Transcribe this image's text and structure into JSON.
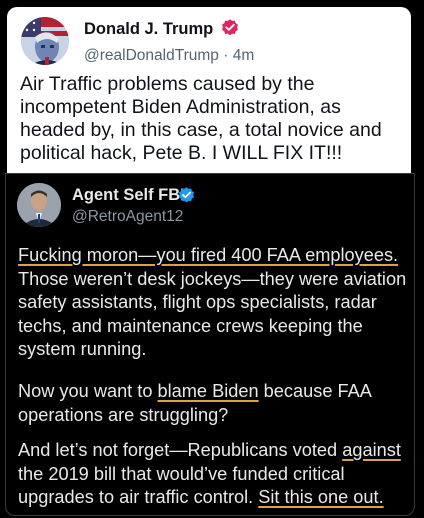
{
  "top_post": {
    "name": "Donald J. Trump",
    "handle": "@realDonaldTrump",
    "separator": "·",
    "time": "4m",
    "text": "Air Traffic problems caused by the incompetent Biden Administration, as headed by, in this case, a total novice and political hack, Pete B. I WILL FIX IT!!!"
  },
  "reply_post": {
    "name": "Agent Self FBI",
    "handle": "@RetroAgent12",
    "p1": {
      "a": "Fucking moron—you fired 400 FAA employees.",
      "b": " Those weren’t desk jockeys—they were aviation safety assistants, flight ops specialists, radar techs, and maintenance crews keeping the system running."
    },
    "p2": {
      "a": "Now you want to ",
      "b": "blame Biden",
      "c": " because FAA operations are struggling?"
    },
    "p3": {
      "a": "And let’s not forget—Republicans voted ",
      "b": "against",
      "c": " the 2019 bill that would’ve funded critical upgrades to air traffic control. ",
      "d": "Sit this one out."
    }
  },
  "colors": {
    "verified_blue": "#1d9bf0",
    "verified_pink": "#e0245e",
    "underline_gold": "#d9a441"
  },
  "icons": [
    "verified-badge-icon",
    "avatar"
  ]
}
